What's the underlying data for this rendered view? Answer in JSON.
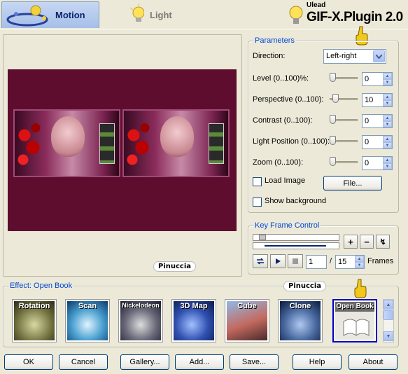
{
  "tabs": [
    {
      "label": "Motion",
      "active": true
    },
    {
      "label": "Light",
      "active": false
    }
  ],
  "brand": {
    "company": "Ulead",
    "product": "GIF-X.Plugin 2.0"
  },
  "preview": {
    "watermark": "Pinuccia",
    "background": "#5e0d2e"
  },
  "parameters": {
    "title": "Parameters",
    "direction": {
      "label": "Direction:",
      "value": "Left-right"
    },
    "rows": [
      {
        "label": "Level (0..100)%:",
        "value": "0",
        "level": 0
      },
      {
        "label": "Perspective (0..100):",
        "value": "10",
        "level": 10
      },
      {
        "label": "Contrast (0..100):",
        "value": "0",
        "level": 0
      },
      {
        "label": "Light Position (0..100):",
        "value": "0",
        "level": 0
      },
      {
        "label": "Zoom (0..100):",
        "value": "0",
        "level": 0
      }
    ],
    "load_image": {
      "label": "Load Image",
      "checked": false
    },
    "file_button": "File...",
    "show_background": {
      "label": "Show background",
      "checked": false
    }
  },
  "keyframe": {
    "title": "Key Frame Control",
    "current_frame": "1",
    "separator": "/",
    "total_frames": "15",
    "frames_label": "Frames"
  },
  "effects": {
    "title": "Effect: Open Book",
    "watermark": "Pinuccia",
    "items": [
      {
        "label": "Rotation",
        "icon": "rotation-icon",
        "selected": false
      },
      {
        "label": "Scan",
        "icon": "scan-icon",
        "selected": false
      },
      {
        "label": "Nickelodeon",
        "icon": "nickelodeon-icon",
        "selected": false
      },
      {
        "label": "3D Map",
        "icon": "3d-map-icon",
        "selected": false
      },
      {
        "label": "Cube",
        "icon": "cube-icon",
        "selected": false
      },
      {
        "label": "Clone",
        "icon": "clone-icon",
        "selected": false
      },
      {
        "label": "Open Book",
        "icon": "open-book-icon",
        "selected": true
      }
    ]
  },
  "buttons": {
    "ok": "OK",
    "cancel": "Cancel",
    "gallery": "Gallery...",
    "add": "Add...",
    "save": "Save...",
    "help": "Help",
    "about": "About"
  },
  "colors": {
    "accent": "#0046d5",
    "selected_border": "#0000c0"
  }
}
